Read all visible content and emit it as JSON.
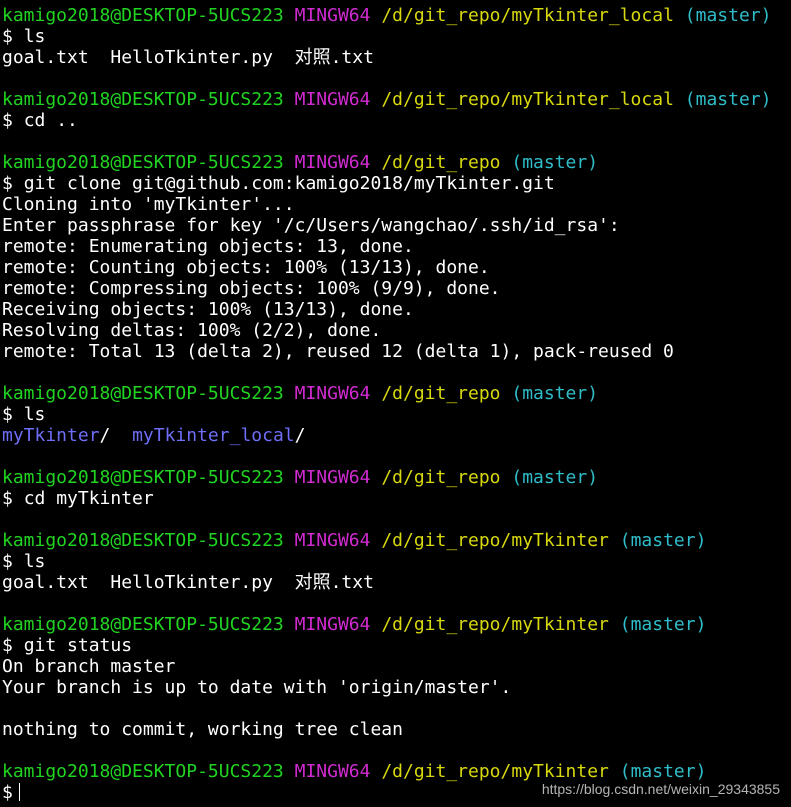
{
  "prompt": {
    "user_host": "kamigo2018@DESKTOP-5UCS223",
    "system": "MINGW64",
    "path_local": "/d/git_repo/myTkinter_local",
    "path_repo": "/d/git_repo",
    "path_mytk": "/d/git_repo/myTkinter",
    "branch": "(master)",
    "symbol": "$"
  },
  "commands": {
    "ls": "ls",
    "cd_up": "cd ..",
    "clone": "git clone git@github.com:kamigo2018/myTkinter.git",
    "cd_mytk": "cd myTkinter",
    "status": "git status"
  },
  "output": {
    "ls_files": "goal.txt  HelloTkinter.py  对照.txt",
    "clone_lines": [
      "Cloning into 'myTkinter'...",
      "Enter passphrase for key '/c/Users/wangchao/.ssh/id_rsa':",
      "remote: Enumerating objects: 13, done.",
      "remote: Counting objects: 100% (13/13), done.",
      "remote: Compressing objects: 100% (9/9), done.",
      "Receiving objects: 100% (13/13), done.",
      "Resolving deltas: 100% (2/2), done.",
      "remote: Total 13 (delta 2), reused 12 (delta 1), pack-reused 0"
    ],
    "dir_1": "myTkinter",
    "dir_2": "myTkinter_local",
    "dir_sep": "/",
    "status_lines": [
      "On branch master",
      "Your branch is up to date with 'origin/master'.",
      "nothing to commit, working tree clean"
    ]
  },
  "watermark": "https://blog.csdn.net/weixin_29343855",
  "colors": {
    "background": "#000000",
    "user_host": "#21d421",
    "system": "#d02bd0",
    "path": "#d8d80e",
    "branch": "#2fbdc9",
    "directory": "#6e6ef8",
    "text": "#ffffff"
  }
}
